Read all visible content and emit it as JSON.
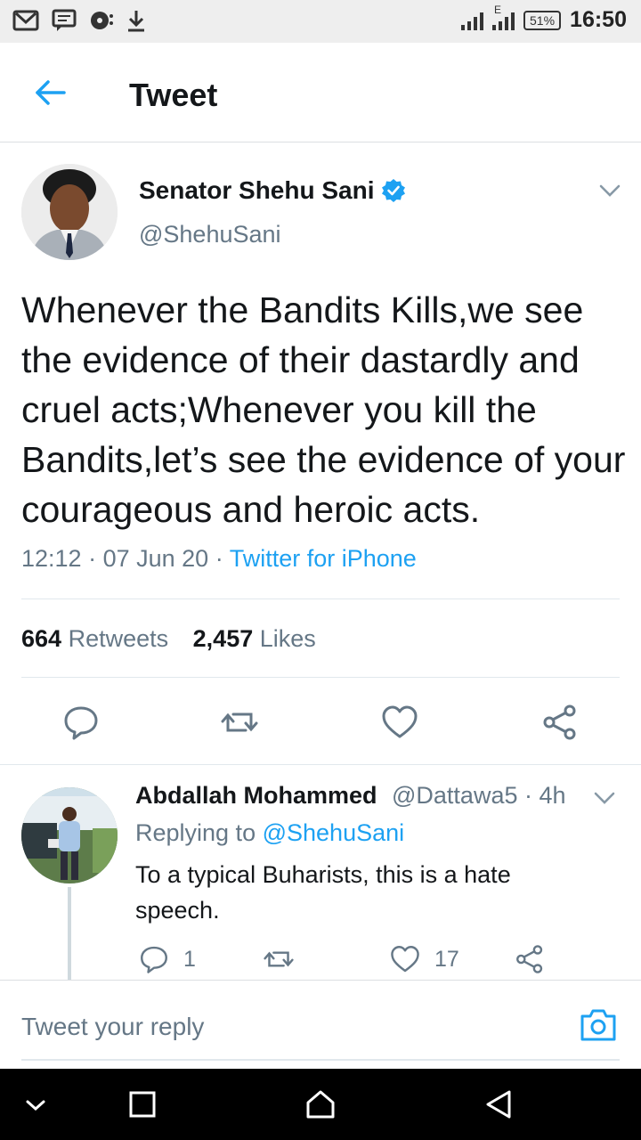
{
  "status_bar": {
    "battery": "51%",
    "time": "16:50",
    "network": "E",
    "icons": [
      "gmail-icon",
      "message-icon",
      "media-icon",
      "download-icon"
    ]
  },
  "header": {
    "title": "Tweet"
  },
  "tweet": {
    "author_name": "Senator Shehu Sani",
    "handle": "@ShehuSani",
    "text": "Whenever the Bandits Kills,we see the evidence of their dastardly and cruel acts;Whenever you kill the Bandits,let’s see the evidence of your courageous and heroic acts.",
    "time": "12:12",
    "date": "07 Jun 20",
    "source": "Twitter for iPhone",
    "retweets_count": "664",
    "retweets_label": "Retweets",
    "likes_count": "2,457",
    "likes_label": "Likes"
  },
  "reply": {
    "author_name": "Abdallah Mohammed",
    "handle": "@Dattawa5",
    "age": "4h",
    "replying_prefix": "Replying to",
    "replying_to": "@ShehuSani",
    "text": "To a typical Buharists, this is a hate speech.",
    "reply_count": "1",
    "like_count": "17"
  },
  "composer": {
    "placeholder": "Tweet your reply"
  },
  "colors": {
    "accent": "#1da1f2",
    "text": "#14171a",
    "muted": "#657786"
  }
}
